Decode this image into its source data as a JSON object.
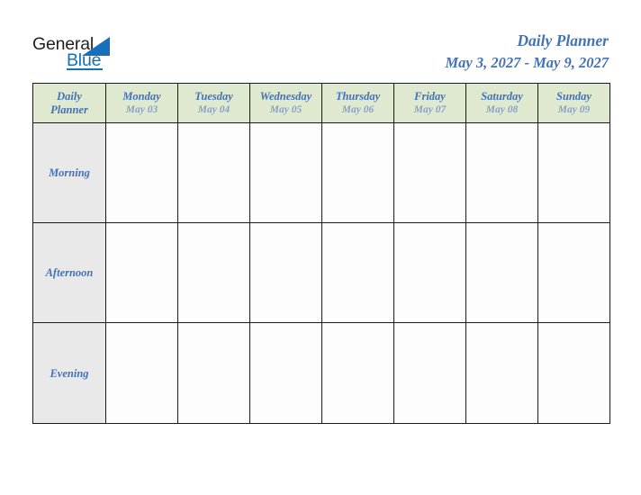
{
  "brand": {
    "name_part1": "General",
    "name_part2": "Blue",
    "triangle_color": "#1670bb",
    "text_color": "#231f20",
    "accent_color": "#1670bb"
  },
  "header": {
    "title": "Daily Planner",
    "date_range": "May 3, 2027 - May 9, 2027",
    "title_color": "#4472b8"
  },
  "table": {
    "corner": {
      "line1": "Daily",
      "line2": "Planner"
    },
    "header_bg": "#dfe9cf",
    "period_bg": "#e9e9e9",
    "border_color": "#1a1a1a",
    "day_name_color": "#4472b8",
    "day_date_color": "#8aa0c4",
    "columns": [
      {
        "day": "Monday",
        "date": "May 03"
      },
      {
        "day": "Tuesday",
        "date": "May 04"
      },
      {
        "day": "Wednesday",
        "date": "May 05"
      },
      {
        "day": "Thursday",
        "date": "May 06"
      },
      {
        "day": "Friday",
        "date": "May 07"
      },
      {
        "day": "Saturday",
        "date": "May 08"
      },
      {
        "day": "Sunday",
        "date": "May 09"
      }
    ],
    "rows": [
      {
        "label": "Morning",
        "cells": [
          "",
          "",
          "",
          "",
          "",
          "",
          ""
        ]
      },
      {
        "label": "Afternoon",
        "cells": [
          "",
          "",
          "",
          "",
          "",
          "",
          ""
        ]
      },
      {
        "label": "Evening",
        "cells": [
          "",
          "",
          "",
          "",
          "",
          "",
          ""
        ]
      }
    ]
  }
}
